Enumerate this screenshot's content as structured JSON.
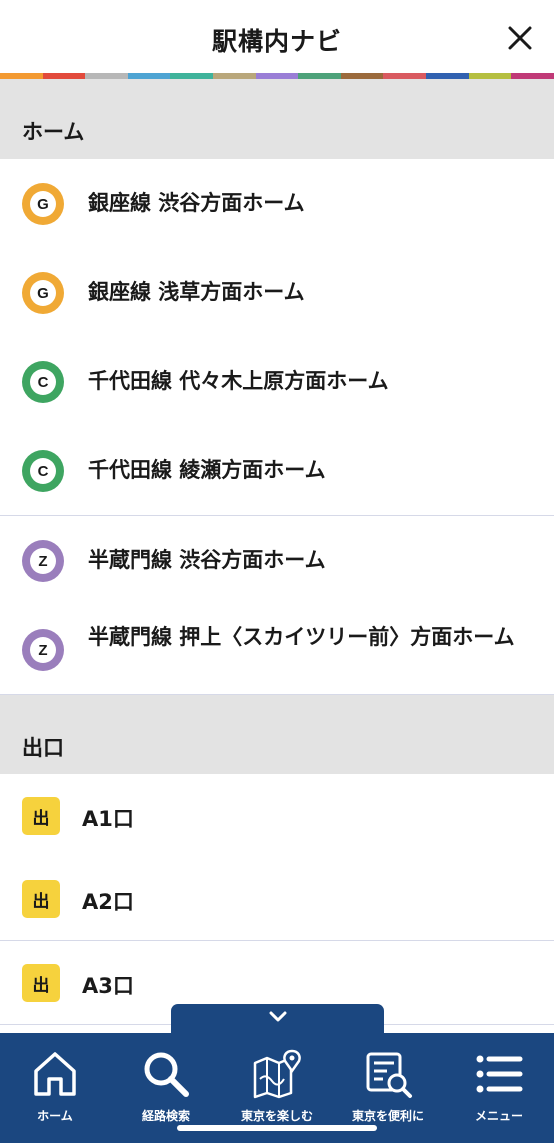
{
  "header": {
    "title": "駅構内ナビ",
    "strip_colors": [
      "#f39a32",
      "#e24a3c",
      "#b7b7b7",
      "#4ea4d3",
      "#3fb39b",
      "#b9a77b",
      "#9a7ed6",
      "#4ea27a",
      "#9b6a3c",
      "#d95a60",
      "#3161b0",
      "#b5bf40",
      "#c03a77"
    ]
  },
  "platforms": {
    "title": "ホーム",
    "items": [
      {
        "letter": "G",
        "color": "#f0a935",
        "label": "銀座線 渋谷方面ホーム"
      },
      {
        "letter": "G",
        "color": "#f0a935",
        "label": "銀座線 浅草方面ホーム"
      },
      {
        "letter": "C",
        "color": "#3ea561",
        "label": "千代田線 代々木上原方面ホーム"
      },
      {
        "letter": "C",
        "color": "#3ea561",
        "label": "千代田線 綾瀬方面ホーム"
      },
      {
        "letter": "Z",
        "color": "#9a7ebc",
        "label": "半蔵門線 渋谷方面ホーム"
      },
      {
        "letter": "Z",
        "color": "#9a7ebc",
        "label": "半蔵門線 押上〈スカイツリー前〉方面ホーム"
      }
    ]
  },
  "exits": {
    "title": "出口",
    "badge_text": "出",
    "items": [
      {
        "label": "A1口"
      },
      {
        "label": "A2口"
      },
      {
        "label": "A3口"
      }
    ]
  },
  "nav": {
    "items": [
      {
        "icon": "home-icon",
        "label": "ホーム"
      },
      {
        "icon": "search-icon",
        "label": "経路検索"
      },
      {
        "icon": "map-icon",
        "label": "東京を楽しむ"
      },
      {
        "icon": "guide-icon",
        "label": "東京を便利に"
      },
      {
        "icon": "menu-icon",
        "label": "メニュー"
      }
    ]
  }
}
